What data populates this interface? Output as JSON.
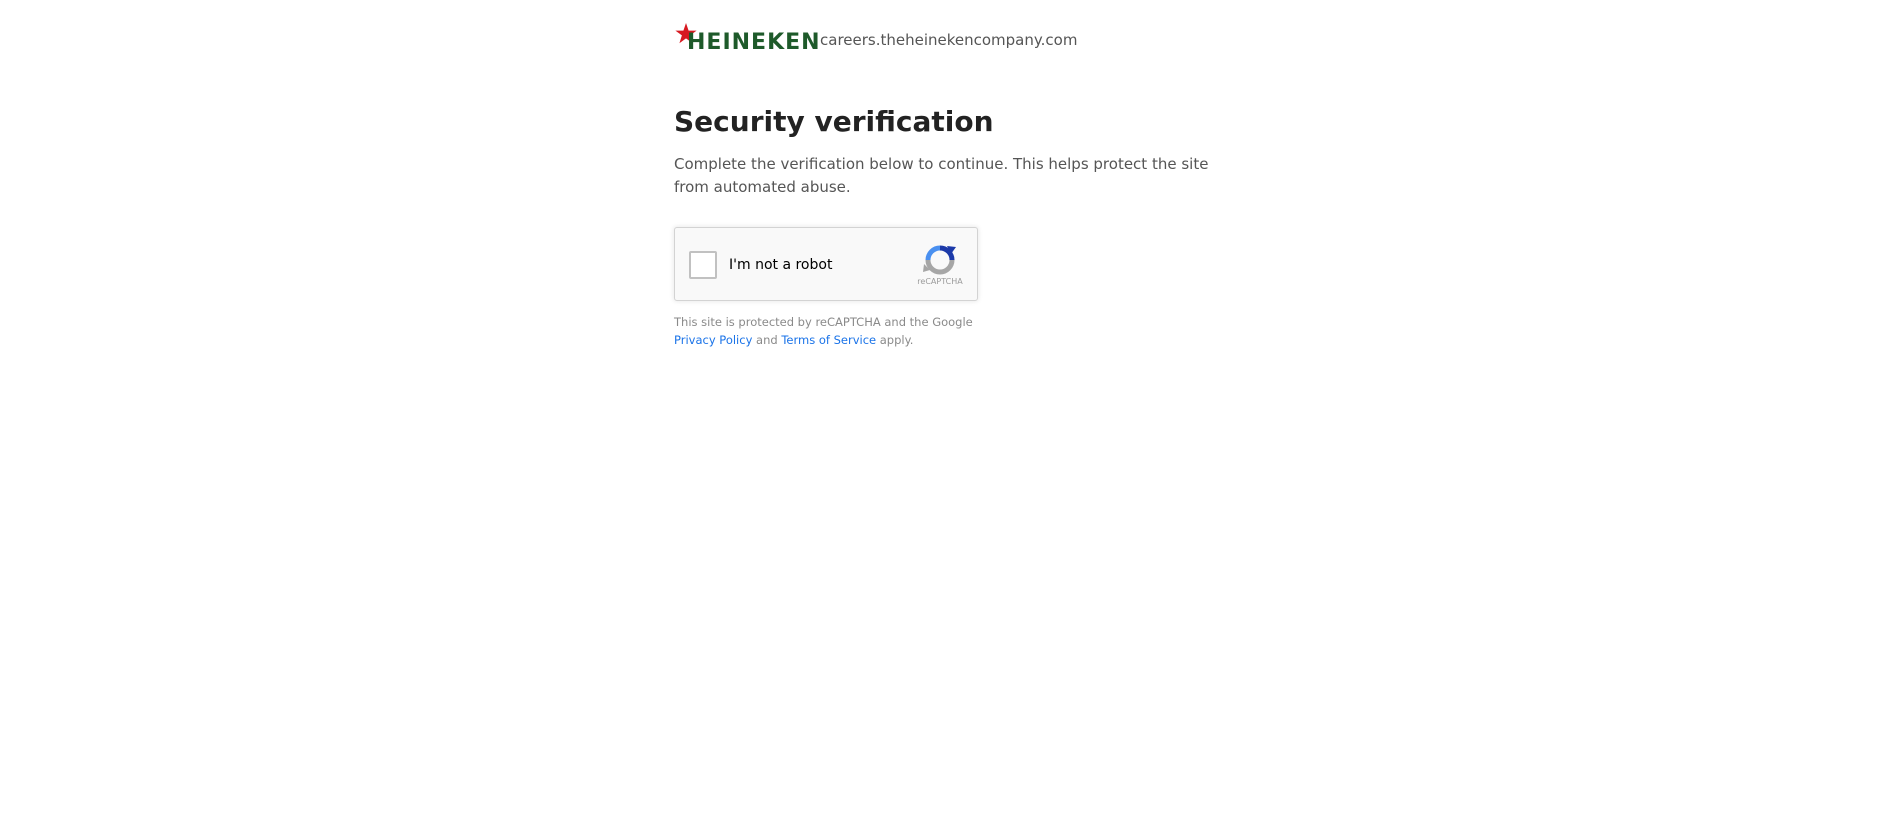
{
  "header": {
    "logo_text": "HEINEKEN",
    "domain": "careers.theheinekencompany.com"
  },
  "main": {
    "title": "Security verification",
    "description": "Complete the verification below to continue. This helps protect the site from automated abuse."
  },
  "recaptcha": {
    "checkbox_label": "I'm not a robot",
    "brand_text": "reCAPTCHA"
  },
  "legal": {
    "prefix": "This site is protected by reCAPTCHA and the Google",
    "privacy_link": "Privacy Policy",
    "and": "and",
    "terms_link": "Terms of Service",
    "suffix": "apply."
  },
  "colors": {
    "brand_green": "#1e5a2a",
    "brand_red": "#d71920",
    "link_blue": "#1a73e8"
  },
  "icons": {
    "logo_star": "red-star-icon",
    "recaptcha": "recaptcha-logo-icon"
  }
}
